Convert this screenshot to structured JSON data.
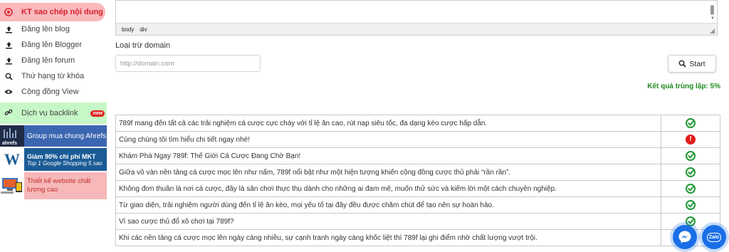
{
  "sidebar": {
    "active": {
      "label": "KT sao chép nội dung",
      "icon": "target-icon"
    },
    "items": [
      {
        "label": "Đăng lên blog",
        "icon": "upload-icon"
      },
      {
        "label": "Đăng lên Blogger",
        "icon": "upload-icon"
      },
      {
        "label": "Đăng lên forum",
        "icon": "upload-icon"
      },
      {
        "label": "Thứ hạng từ khóa",
        "icon": "search-icon"
      },
      {
        "label": "Cộng đồng View",
        "icon": "eye-icon"
      }
    ],
    "backlink": {
      "label": "Dịch vụ backlink",
      "badge": "new",
      "icon": "link-icon"
    },
    "promos": [
      {
        "label": "Group mua chung Ahrefs",
        "thumb_text": "ahrefs"
      },
      {
        "title": "Giảm 90% chi phí MKT",
        "subtitle": "Top 1 Google Shopping 5 sao",
        "thumb_text": "W"
      },
      {
        "label": "Thiết kế website chất lượng cao"
      }
    ]
  },
  "editor": {
    "status_path": [
      "body",
      "div"
    ]
  },
  "exclude": {
    "label": "Loại trừ domain",
    "placeholder": "http://domain.com"
  },
  "start_button": {
    "label": "Start",
    "icon": "search-icon"
  },
  "result_text": "Kết quả trùng lặp: 5%",
  "rows": [
    {
      "text": "789f mang đến tất cả các trải nghiệm cá cược cực cháy với tỉ lệ ăn cao, rút nạp siêu tốc, đa dạng kèo cược hấp dẫn.",
      "status": "ok"
    },
    {
      "text": "Cùng chúng tôi tìm hiểu chi tiết ngay nhé!",
      "status": "error"
    },
    {
      "text": "Khám Phá Ngay 789f: Thế Giới Cá Cược Đang Chờ Bạn!",
      "status": "ok"
    },
    {
      "text": "Giữa vô vàn nền tảng cá cược mọc lên như nấm, 789f  nổi bật như một hiện tượng khiến cộng đồng cược thủ phải “rần rần”.",
      "status": "ok"
    },
    {
      "text": "Không đơn thuần là nơi cá cược, đây là sân chơi thực thụ dành cho những ai đam mê, muốn thử sức và kiếm lời một cách chuyên nghiệp.",
      "status": "ok"
    },
    {
      "text": "Từ giao diện, trải nghiệm người dùng đến tỉ lệ ăn kèo, mọi yếu tố tại đây đều được chăm chút để tạo nên sự hoàn hảo.",
      "status": "ok"
    },
    {
      "text": "Vì sao cược thủ đổ xô chơi tại 789f?",
      "status": "ok"
    },
    {
      "text": "Khi các nền tảng cá cược mọc lên ngày càng nhiều, sự cạnh tranh ngày càng khốc liệt thì 789f lại ghi điểm nhờ chất lượng vượt trội.",
      "status": "ok"
    }
  ],
  "floating": {
    "zalo_label": "Zalo"
  }
}
